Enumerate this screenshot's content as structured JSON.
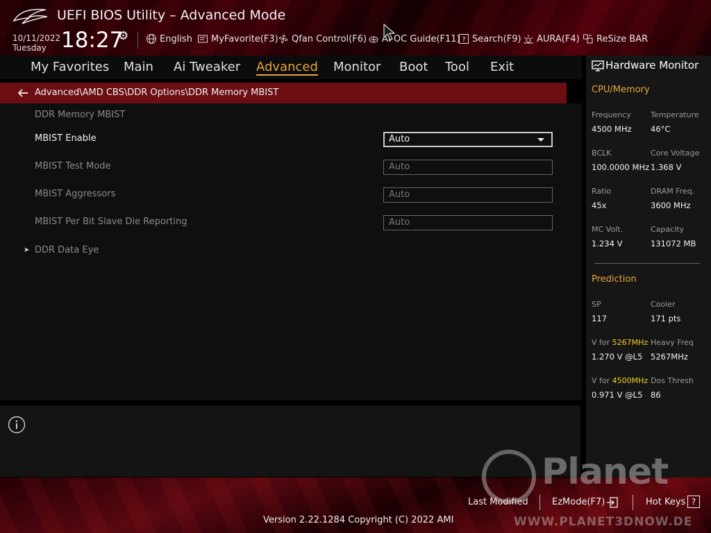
{
  "header": {
    "title": "UEFI BIOS Utility – Advanced Mode",
    "date": "10/11/2022",
    "day": "Tuesday",
    "time": "18:27",
    "toolbar": [
      {
        "label": "English",
        "icon": "globe-icon"
      },
      {
        "label": "MyFavorite(F3)",
        "icon": "favorite-icon"
      },
      {
        "label": "Qfan Control(F6)",
        "icon": "fan-icon"
      },
      {
        "label": "AI OC Guide(F11)",
        "icon": "oc-guide-icon"
      },
      {
        "label": "Search(F9)",
        "icon": "search-icon"
      },
      {
        "label": "AURA(F4)",
        "icon": "aura-icon"
      },
      {
        "label": "ReSize BAR",
        "icon": "resize-bar-icon"
      }
    ]
  },
  "menu": {
    "tabs": [
      "My Favorites",
      "Main",
      "Ai Tweaker",
      "Advanced",
      "Monitor",
      "Boot",
      "Tool",
      "Exit"
    ],
    "active": "Advanced"
  },
  "breadcrumb": "Advanced\\AMD CBS\\DDR Options\\DDR Memory MBIST",
  "main": {
    "section_title": "DDR Memory MBIST",
    "settings": [
      {
        "label": "MBIST Enable",
        "value": "Auto"
      },
      {
        "label": "MBIST Test Mode",
        "value": "Auto"
      },
      {
        "label": "MBIST Aggressors",
        "value": "Auto"
      },
      {
        "label": "MBIST Per Bit Slave Die Reporting",
        "value": "Auto"
      }
    ],
    "submenu": "DDR Data Eye"
  },
  "hardware_monitor": {
    "title": "Hardware Monitor",
    "cpu_memory": {
      "heading": "CPU/Memory",
      "items": [
        {
          "label": "Frequency",
          "value": "4500 MHz"
        },
        {
          "label": "Temperature",
          "value": "46°C"
        },
        {
          "label": "BCLK",
          "value": "100.0000 MHz"
        },
        {
          "label": "Core Voltage",
          "value": "1.368 V"
        },
        {
          "label": "Ratio",
          "value": "45x"
        },
        {
          "label": "DRAM Freq.",
          "value": "3600 MHz"
        },
        {
          "label": "MC Volt.",
          "value": "1.234 V"
        },
        {
          "label": "Capacity",
          "value": "131072 MB"
        }
      ]
    },
    "prediction": {
      "heading": "Prediction",
      "sp_label": "SP",
      "sp_value": "117",
      "cooler_label": "Cooler",
      "cooler_value": "171 pts",
      "vfor_label": "V for",
      "vfor1_freq": "5267MHz",
      "vfor1_value": "1.270 V @L5",
      "heavy_label": "Heavy Freq",
      "heavy_value": "5267MHz",
      "vfor2_freq": "4500MHz",
      "vfor2_value": "0.971 V @L5",
      "dos_label": "Dos Thresh",
      "dos_value": "86"
    }
  },
  "footer": {
    "last_modified": "Last Modified",
    "ezmode": "EzMode(F7)",
    "hot_keys": "Hot Keys",
    "hot_keys_glyph": "?",
    "version": "Version 2.22.1284 Copyright (C) 2022 AMI"
  },
  "watermark": {
    "brand": "Planet",
    "url": "WWW.PLANET3DNOW.DE"
  },
  "colors": {
    "accent": "#e8a33c",
    "breadcrumb_bg": "#6b0f12",
    "highlight": "#f0d020"
  }
}
